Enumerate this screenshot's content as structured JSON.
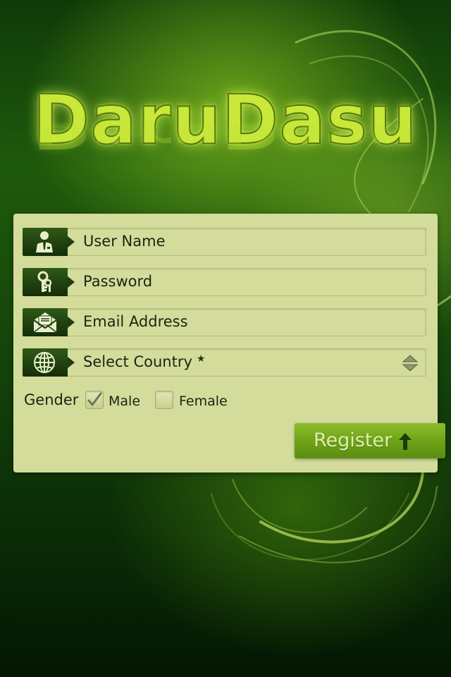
{
  "app": {
    "logo_text": "DaruDasu"
  },
  "form": {
    "username_placeholder": "User Name",
    "password_placeholder": "Password",
    "email_placeholder": "Email Address",
    "country_select": {
      "selected": "Select Country",
      "required_marker": "★"
    },
    "gender": {
      "label": "Gender",
      "options": [
        {
          "label": "Male",
          "checked": true
        },
        {
          "label": "Female",
          "checked": false
        }
      ]
    },
    "register_label": "Register"
  },
  "colors": {
    "panel": "#d4dc9c",
    "icon_tab": "#1d3e0d",
    "button": "#78ac1c",
    "logo": "#c8e83a"
  },
  "icons": {
    "username": "user-icon",
    "password": "key-icon",
    "email": "envelope-icon",
    "country": "globe-icon",
    "register": "arrow-up-icon"
  }
}
